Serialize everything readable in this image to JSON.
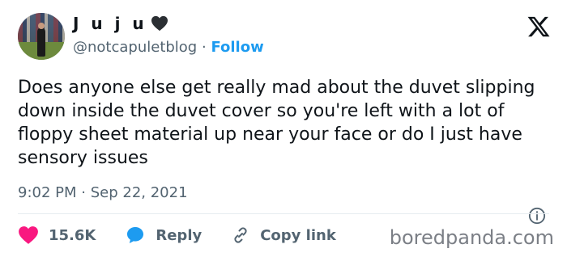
{
  "author": {
    "display_name": "J u j u",
    "heart_icon": "black-heart",
    "handle": "@notcapuletblog",
    "separator": "·",
    "follow_label": "Follow"
  },
  "logo": {
    "icon": "x-logo"
  },
  "tweet": {
    "text": "Does anyone else get really mad about the duvet slipping down inside the duvet cover so you're left with a lot of floppy sheet material up near your face or do I just have sensory issues",
    "time": "9:02 PM",
    "date_separator": "·",
    "date": "Sep 22, 2021"
  },
  "actions": {
    "likes": {
      "count": "15.6K",
      "icon": "heart-icon",
      "color": "#f91880"
    },
    "reply": {
      "label": "Reply",
      "icon": "reply-bubble-icon",
      "color": "#1d9bf0"
    },
    "copy_link": {
      "label": "Copy link",
      "icon": "link-icon"
    }
  },
  "watermark": "boredpanda.com",
  "colors": {
    "accent": "#1d9bf0",
    "text": "#0f1419",
    "secondary": "#536471"
  }
}
